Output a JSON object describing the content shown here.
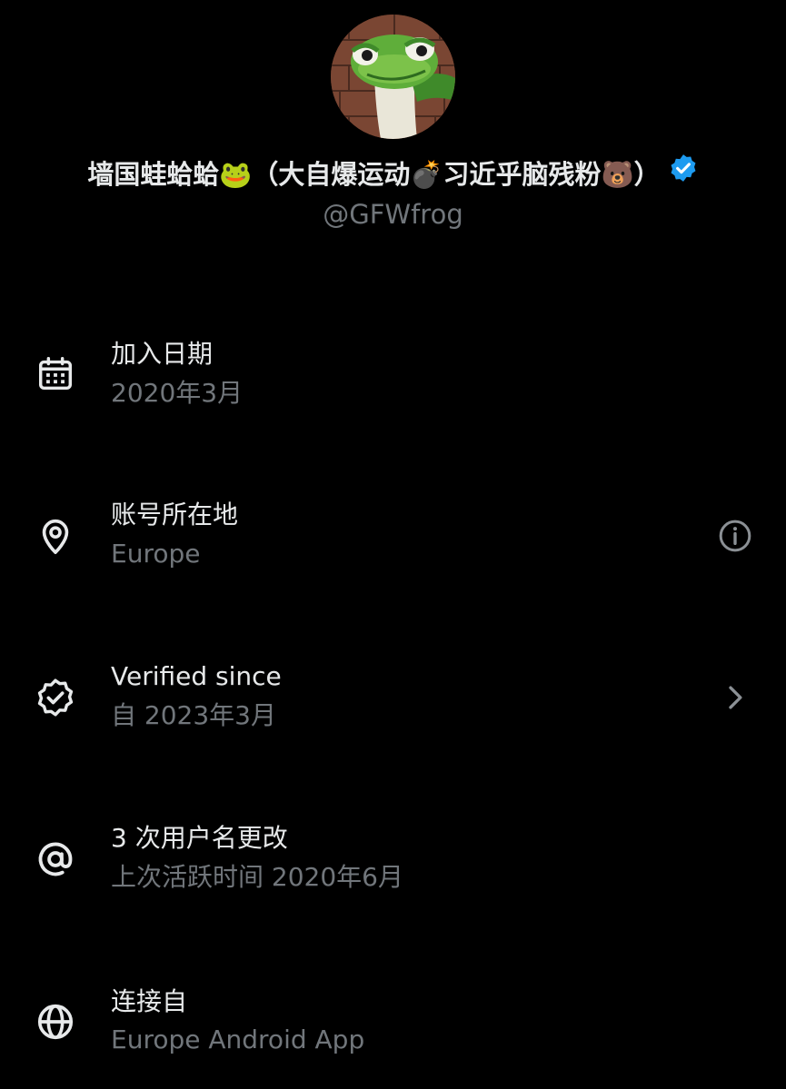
{
  "profile": {
    "display_name": "墙国蛙蛤蛤🐸（大自爆运动💣习近乎脑残粉🐻）",
    "handle": "@GFWfrog",
    "verified": true
  },
  "colors": {
    "background": "#000000",
    "primary_text": "#e7e9ea",
    "secondary_text": "#71767b",
    "verified_badge": "#1d9bf0"
  },
  "rows": [
    {
      "icon": "calendar-icon",
      "title": "加入日期",
      "subtitle": "2020年3月"
    },
    {
      "icon": "location-pin-icon",
      "title": "账号所在地",
      "subtitle": "Europe",
      "trailing_icon": "info-icon"
    },
    {
      "icon": "verified-badge-icon",
      "title": "Verified since",
      "subtitle": "自 2023年3月",
      "trailing_icon": "chevron-right-icon"
    },
    {
      "icon": "at-sign-icon",
      "title": "3 次用户名更改",
      "subtitle": "上次活跃时间 2020年6月"
    },
    {
      "icon": "globe-icon",
      "title": "连接自",
      "subtitle": "Europe Android App"
    }
  ]
}
